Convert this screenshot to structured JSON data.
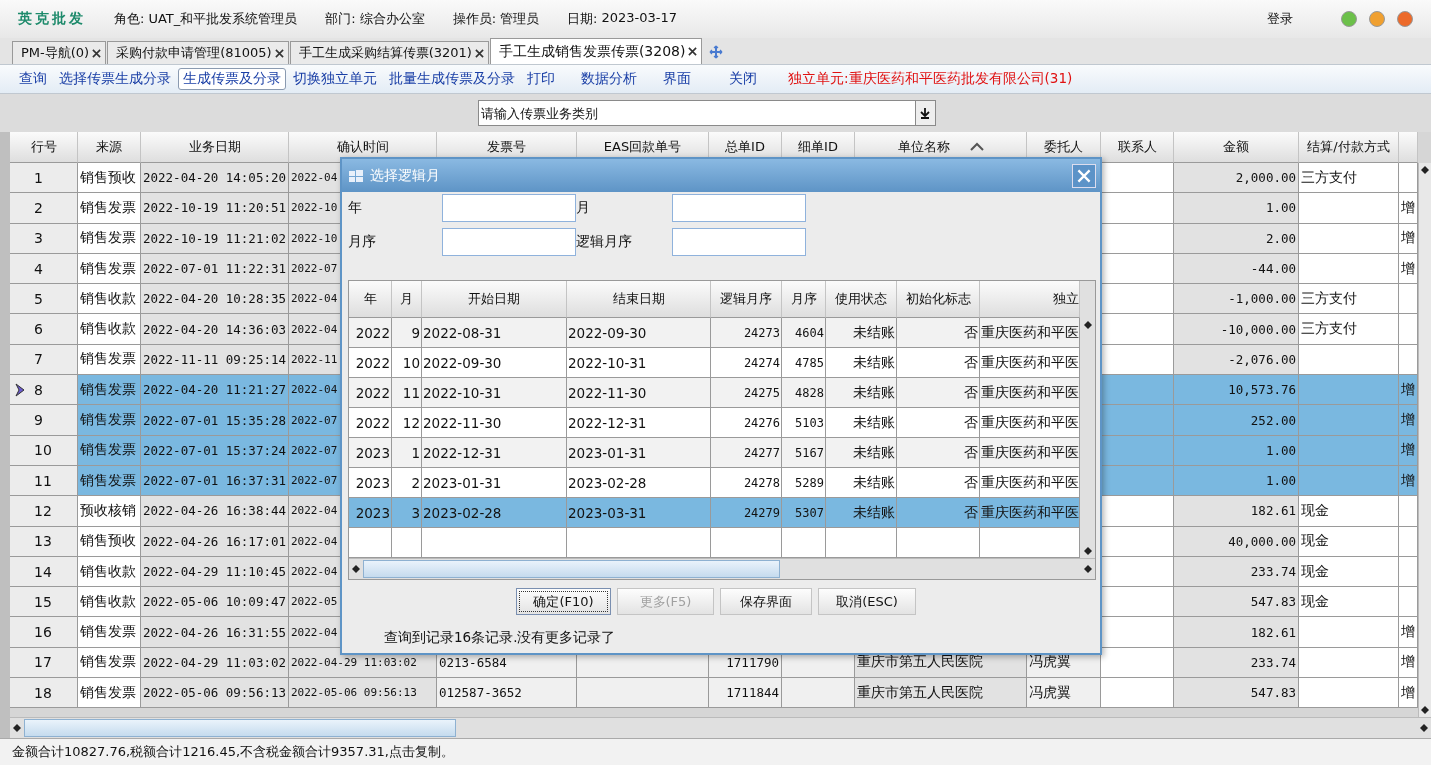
{
  "header": {
    "app_name": "英克批发",
    "info": [
      {
        "label": "角色:",
        "value": "UAT_和平批发系统管理员"
      },
      {
        "label": "部门:",
        "value": "综合办公室"
      },
      {
        "label": "操作员:",
        "value": "管理员"
      },
      {
        "label": "日期:",
        "value": "2023-03-17"
      }
    ],
    "login": "登录"
  },
  "tabs": [
    {
      "label": "PM-导航(0)",
      "selected": false
    },
    {
      "label": "采购付款申请管理(81005)",
      "selected": false
    },
    {
      "label": "手工生成采购结算传票(3201)",
      "selected": false
    },
    {
      "label": "手工生成销售发票传票(3208)",
      "selected": true
    }
  ],
  "toolbar": [
    {
      "label": "查询",
      "selected": false
    },
    {
      "label": "选择传票生成分录",
      "selected": false
    },
    {
      "label": "生成传票及分录",
      "selected": true
    },
    {
      "label": "切换独立单元",
      "selected": false
    },
    {
      "label": "批量生成传票及分录",
      "selected": false
    },
    {
      "label": "打印",
      "selected": false
    },
    {
      "label": "数据分析",
      "selected": false
    },
    {
      "label": "界面",
      "selected": false
    },
    {
      "label": "关闭",
      "selected": false
    }
  ],
  "unit_notice": "独立单元:重庆医药和平医药批发有限公司(31)",
  "category_select": {
    "placeholder": "请输入传票业务类别"
  },
  "table": {
    "columns": [
      {
        "label": "行号"
      },
      {
        "label": "来源"
      },
      {
        "label": "业务日期"
      },
      {
        "label": "确认时间"
      },
      {
        "label": "发票号"
      },
      {
        "label": "EAS回款单号"
      },
      {
        "label": "总单ID"
      },
      {
        "label": "细单ID"
      },
      {
        "label": "单位名称"
      },
      {
        "label": "委托人"
      },
      {
        "label": "联系人"
      },
      {
        "label": "金额"
      },
      {
        "label": "结算/付款方式"
      }
    ],
    "rows": [
      {
        "selected": false,
        "current": false,
        "no": "1",
        "source": "销售预收",
        "biz_date": "2022-04-20 14:05:20",
        "confirm_time": "2022-04",
        "amount": "2,000.00",
        "settlement": "三方支付"
      },
      {
        "selected": false,
        "current": false,
        "no": "2",
        "source": "销售发票",
        "biz_date": "2022-10-19 11:20:51",
        "confirm_time": "2022-10",
        "amount": "1.00",
        "column_14": "增"
      },
      {
        "selected": false,
        "current": false,
        "no": "3",
        "source": "销售发票",
        "biz_date": "2022-10-19 11:21:02",
        "confirm_time": "2022-10",
        "amount": "2.00",
        "column_14": "增"
      },
      {
        "selected": false,
        "current": false,
        "no": "4",
        "source": "销售发票",
        "biz_date": "2022-07-01 11:22:31",
        "confirm_time": "2022-07",
        "amount": "-44.00",
        "column_14": "增"
      },
      {
        "selected": false,
        "current": false,
        "no": "5",
        "source": "销售收款",
        "biz_date": "2022-04-20 10:28:35",
        "confirm_time": "2022-04",
        "amount": "-1,000.00",
        "settlement": "三方支付"
      },
      {
        "selected": false,
        "current": false,
        "no": "6",
        "source": "销售收款",
        "biz_date": "2022-04-20 14:36:03",
        "confirm_time": "2022-04",
        "amount": "-10,000.00",
        "settlement": "三方支付"
      },
      {
        "selected": false,
        "current": false,
        "no": "7",
        "source": "销售发票",
        "biz_date": "2022-11-11 09:25:14",
        "confirm_time": "2022-11",
        "amount": "-2,076.00"
      },
      {
        "selected": true,
        "current": true,
        "no": "8",
        "source": "销售发票",
        "biz_date": "2022-04-20 11:21:27",
        "confirm_time": "2022-04",
        "amount": "10,573.76",
        "column_14": "增"
      },
      {
        "selected": true,
        "current": false,
        "no": "9",
        "source": "销售发票",
        "biz_date": "2022-07-01 15:35:28",
        "confirm_time": "2022-07",
        "amount": "252.00",
        "column_14": "增"
      },
      {
        "selected": true,
        "current": false,
        "no": "10",
        "source": "销售发票",
        "biz_date": "2022-07-01 15:37:24",
        "confirm_time": "2022-07",
        "amount": "1.00",
        "column_14": "增"
      },
      {
        "selected": true,
        "current": false,
        "no": "11",
        "source": "销售发票",
        "biz_date": "2022-07-01 16:37:31",
        "confirm_time": "2022-07",
        "amount": "1.00",
        "column_14": "增"
      },
      {
        "selected": false,
        "current": false,
        "no": "12",
        "source": "预收核销",
        "biz_date": "2022-04-26 16:38:44",
        "confirm_time": "2022-04",
        "amount": "182.61",
        "settlement": "现金"
      },
      {
        "selected": false,
        "current": false,
        "no": "13",
        "source": "销售预收",
        "biz_date": "2022-04-26 16:17:01",
        "confirm_time": "2022-04",
        "amount": "40,000.00",
        "settlement": "现金"
      },
      {
        "selected": false,
        "current": false,
        "no": "14",
        "source": "销售收款",
        "biz_date": "2022-04-29 11:10:45",
        "confirm_time": "2022-04",
        "amount": "233.74",
        "settlement": "现金"
      },
      {
        "selected": false,
        "current": false,
        "no": "15",
        "source": "销售收款",
        "biz_date": "2022-05-06 10:09:47",
        "confirm_time": "2022-05",
        "amount": "547.83",
        "settlement": "现金"
      },
      {
        "selected": false,
        "current": false,
        "no": "16",
        "source": "销售发票",
        "biz_date": "2022-04-26 16:31:55",
        "confirm_time": "2022-04",
        "amount": "182.61",
        "column_14": "增"
      },
      {
        "selected": false,
        "current": false,
        "no": "17",
        "source": "销售发票",
        "biz_date": "2022-04-29 11:03:02",
        "confirm_time": "2022-04-29 11:03:02",
        "invoice_no": "0213-6584",
        "order_id": "1711790",
        "unit": "重庆市第五人民医院",
        "consignor": "冯虎翼",
        "amount": "233.74",
        "column_14": "增"
      },
      {
        "selected": false,
        "current": false,
        "no": "18",
        "source": "销售发票",
        "biz_date": "2022-05-06 09:56:13",
        "confirm_time": "2022-05-06 09:56:13",
        "invoice_no": "012587-3652",
        "order_id": "1711844",
        "unit": "重庆市第五人民医院",
        "consignor": "冯虎翼",
        "amount": "547.83",
        "column_14": "增"
      }
    ]
  },
  "status_bar": "金额合计10827.76,税额合计1216.45,不含税金额合计9357.31,点击复制。",
  "dialog": {
    "title": "选择逻辑月",
    "fields": [
      {
        "label": "年"
      },
      {
        "label": "月"
      },
      {
        "label": "月序"
      },
      {
        "label": "逻辑月序"
      }
    ],
    "columns": [
      {
        "label": "年"
      },
      {
        "label": "月"
      },
      {
        "label": "开始日期"
      },
      {
        "label": "结束日期"
      },
      {
        "label": "逻辑月序"
      },
      {
        "label": "月序"
      },
      {
        "label": "使用状态"
      },
      {
        "label": "初始化标志"
      },
      {
        "label": "独立"
      }
    ],
    "rows": [
      {
        "selected": false,
        "year": "2022",
        "month": "9",
        "start": "2022-08-31",
        "end": "2022-09-30",
        "logic_seq": "24273",
        "seq": "4604",
        "status": "未结账",
        "init": "否",
        "unit": "重庆医药和平医"
      },
      {
        "selected": false,
        "year": "2022",
        "month": "10",
        "start": "2022-09-30",
        "end": "2022-10-31",
        "logic_seq": "24274",
        "seq": "4785",
        "status": "未结账",
        "init": "否",
        "unit": "重庆医药和平医"
      },
      {
        "selected": false,
        "year": "2022",
        "month": "11",
        "start": "2022-10-31",
        "end": "2022-11-30",
        "logic_seq": "24275",
        "seq": "4828",
        "status": "未结账",
        "init": "否",
        "unit": "重庆医药和平医"
      },
      {
        "selected": false,
        "year": "2022",
        "month": "12",
        "start": "2022-11-30",
        "end": "2022-12-31",
        "logic_seq": "24276",
        "seq": "5103",
        "status": "未结账",
        "init": "否",
        "unit": "重庆医药和平医"
      },
      {
        "selected": false,
        "year": "2023",
        "month": "1",
        "start": "2022-12-31",
        "end": "2023-01-31",
        "logic_seq": "24277",
        "seq": "5167",
        "status": "未结账",
        "init": "否",
        "unit": "重庆医药和平医"
      },
      {
        "selected": false,
        "year": "2023",
        "month": "2",
        "start": "2023-01-31",
        "end": "2023-02-28",
        "logic_seq": "24278",
        "seq": "5289",
        "status": "未结账",
        "init": "否",
        "unit": "重庆医药和平医"
      },
      {
        "selected": true,
        "year": "2023",
        "month": "3",
        "start": "2023-02-28",
        "end": "2023-03-31",
        "logic_seq": "24279",
        "seq": "5307",
        "status": "未结账",
        "init": "否",
        "unit": "重庆医药和平医"
      }
    ],
    "buttons": [
      {
        "label": "确定(F10)",
        "focused": true,
        "disabled": false
      },
      {
        "label": "更多(F5)",
        "focused": false,
        "disabled": true
      },
      {
        "label": "保存界面",
        "focused": false,
        "disabled": false
      },
      {
        "label": "取消(ESC)",
        "focused": false,
        "disabled": false
      }
    ],
    "message": "查询到记录16条记录.没有更多记录了"
  }
}
